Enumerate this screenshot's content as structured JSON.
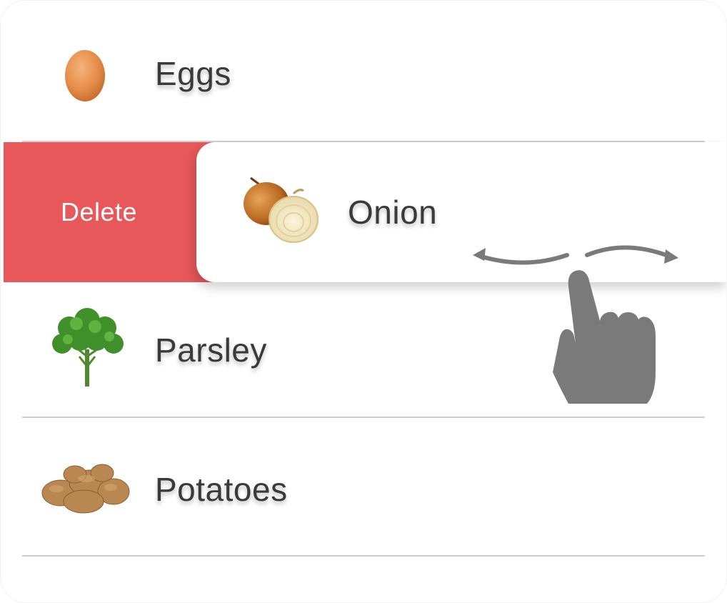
{
  "list": {
    "items": [
      {
        "label": "Eggs",
        "icon": "egg-icon"
      },
      {
        "label": "Onion",
        "icon": "onion-icon",
        "swiped": true
      },
      {
        "label": "Parsley",
        "icon": "parsley-icon"
      },
      {
        "label": "Potatoes",
        "icon": "potatoes-icon"
      }
    ]
  },
  "swipe_action": {
    "label": "Delete",
    "color": "#e8585a"
  },
  "gesture_hint": {
    "icon": "swipe-hand-icon",
    "color": "#7a7a7a"
  }
}
